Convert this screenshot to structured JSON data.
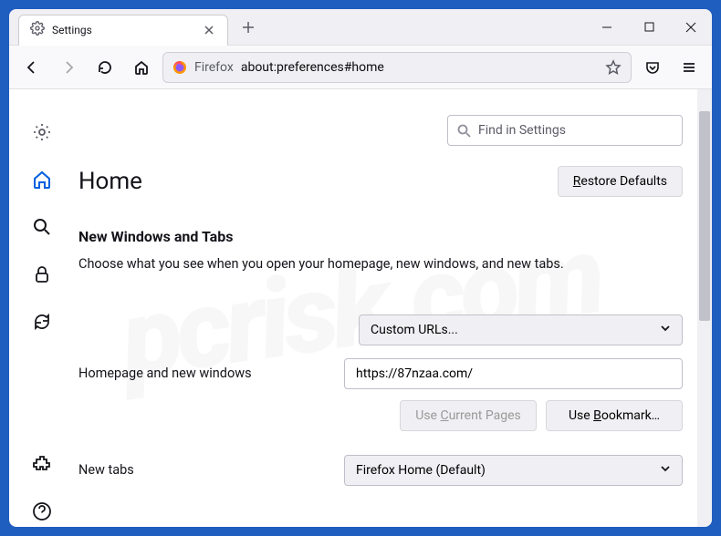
{
  "tab": {
    "title": "Settings"
  },
  "urlbar": {
    "identity_label": "Firefox",
    "url": "about:preferences#home"
  },
  "sidebar": {
    "items": [
      {
        "name": "general",
        "active": false
      },
      {
        "name": "home",
        "active": true
      },
      {
        "name": "search",
        "active": false
      },
      {
        "name": "privacy",
        "active": false
      },
      {
        "name": "sync",
        "active": false
      }
    ]
  },
  "search": {
    "placeholder": "Find in Settings"
  },
  "page": {
    "title": "Home",
    "restore_defaults": "Restore Defaults",
    "section_title": "New Windows and Tabs",
    "section_desc": "Choose what you see when you open your homepage, new windows, and new tabs.",
    "homepage_row_label": "Homepage and new windows",
    "homepage_dropdown": "Custom URLs...",
    "homepage_url": "https://87nzaa.com/",
    "use_current": "Use Current Pages",
    "use_bookmark": "Use Bookmark…",
    "newtabs_row_label": "New tabs",
    "newtabs_dropdown": "Firefox Home (Default)"
  }
}
